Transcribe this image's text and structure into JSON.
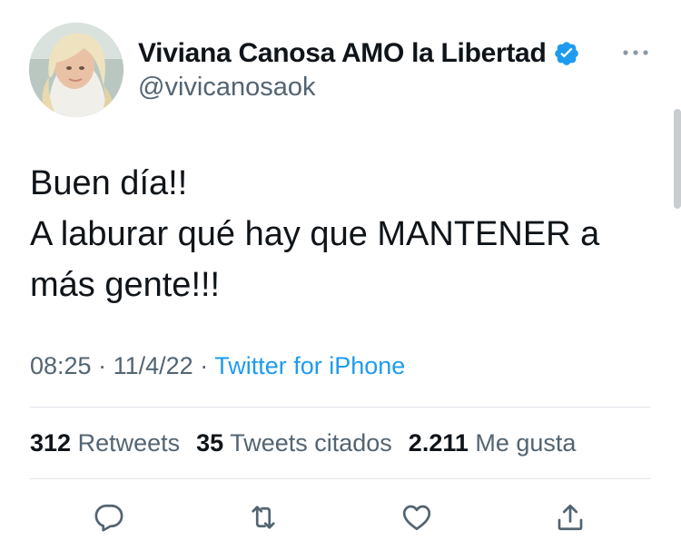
{
  "user": {
    "display_name": "Viviana Canosa AMO la Libertad",
    "handle": "@vivicanosaok",
    "verified": true
  },
  "tweet": {
    "lines": [
      "Buen día!!",
      "A laburar qué hay que MANTENER a",
      "más gente!!!"
    ],
    "time": "08:25",
    "date": "11/4/22",
    "source": "Twitter for iPhone",
    "separator": "·"
  },
  "stats": {
    "retweets_count": "312",
    "retweets_label": "Retweets",
    "quotes_count": "35",
    "quotes_label": "Tweets citados",
    "likes_count": "2.211",
    "likes_label": "Me gusta"
  },
  "icons": {
    "more": "more-horizontal-icon",
    "verified": "verified-badge-icon",
    "reply": "reply-icon",
    "retweet": "retweet-icon",
    "like": "heart-icon",
    "share": "share-icon"
  },
  "colors": {
    "accent": "#1d9bf0",
    "text_primary": "#0f1419",
    "text_secondary": "#536471",
    "divider": "#e1e6ea"
  }
}
